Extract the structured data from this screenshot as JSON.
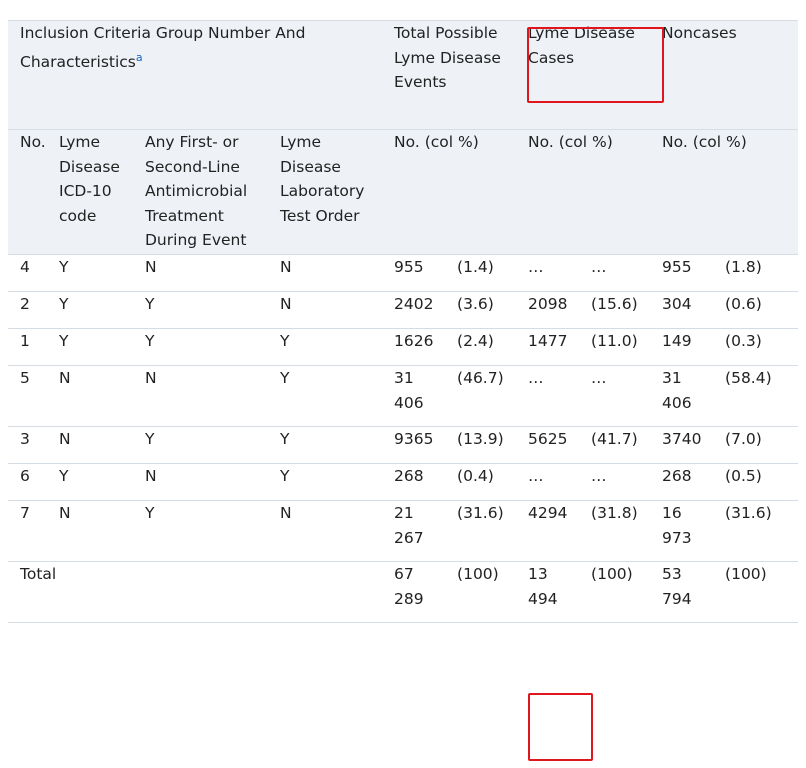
{
  "header": {
    "group_title": "Inclusion Criteria Group Number And Characteristics",
    "footnote": "a",
    "total": "Total Possible Lyme Disease Events",
    "cases": "Lyme Disease Cases",
    "noncases": "Noncases",
    "sub_no": "No.",
    "sub_icd": "Lyme Disease ICD-10 code",
    "sub_anti": "Any First- or Second-Line Antimicrobial Treatment During Event",
    "sub_lab": "Lyme Disease Laboratory Test Order",
    "sub_col": "No. (col %)"
  },
  "rows": [
    {
      "no": "4",
      "icd": "Y",
      "anti": "N",
      "lab": "N",
      "t_n": "955",
      "t_p": "(1.4)",
      "c_n": "…",
      "c_p": "…",
      "n_n": "955",
      "n_p": "(1.8)"
    },
    {
      "no": "2",
      "icd": "Y",
      "anti": "Y",
      "lab": "N",
      "t_n": "2402",
      "t_p": "(3.6)",
      "c_n": "2098",
      "c_p": "(15.6)",
      "n_n": "304",
      "n_p": "(0.6)"
    },
    {
      "no": "1",
      "icd": "Y",
      "anti": "Y",
      "lab": "Y",
      "t_n": "1626",
      "t_p": "(2.4)",
      "c_n": "1477",
      "c_p": "(11.0)",
      "n_n": "149",
      "n_p": "(0.3)"
    },
    {
      "no": "5",
      "icd": "N",
      "anti": "N",
      "lab": "Y",
      "t_n": "31 406",
      "t_p": "(46.7)",
      "c_n": "…",
      "c_p": "…",
      "n_n": "31 406",
      "n_p": "(58.4)"
    },
    {
      "no": "3",
      "icd": "N",
      "anti": "Y",
      "lab": "Y",
      "t_n": "9365",
      "t_p": "(13.9)",
      "c_n": "5625",
      "c_p": "(41.7)",
      "n_n": "3740",
      "n_p": "(7.0)"
    },
    {
      "no": "6",
      "icd": "Y",
      "anti": "N",
      "lab": "Y",
      "t_n": "268",
      "t_p": "(0.4)",
      "c_n": "…",
      "c_p": "…",
      "n_n": "268",
      "n_p": "(0.5)"
    },
    {
      "no": "7",
      "icd": "N",
      "anti": "Y",
      "lab": "N",
      "t_n": "21 267",
      "t_p": "(31.6)",
      "c_n": "4294",
      "c_p": "(31.8)",
      "n_n": "16 973",
      "n_p": "(31.6)"
    }
  ],
  "total_row": {
    "label": "Total",
    "t_n": "67 289",
    "t_p": "(100)",
    "c_n": "13 494",
    "c_p": "(100)",
    "n_n": "53 794",
    "n_p": "(100)"
  }
}
